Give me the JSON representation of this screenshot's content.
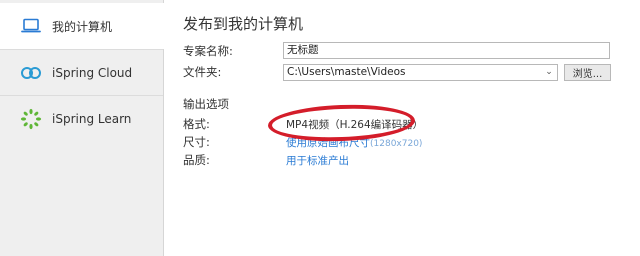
{
  "sidebar": {
    "items": [
      {
        "label": "我的计算机",
        "icon": "laptop-icon"
      },
      {
        "label": "iSpring Cloud",
        "icon": "cloud-icon"
      },
      {
        "label": "iSpring Learn",
        "icon": "learn-icon"
      }
    ]
  },
  "main": {
    "title": "发布到我的计算机",
    "project_name": {
      "label": "专案名称:",
      "value": "无标题"
    },
    "folder": {
      "label": "文件夹:",
      "value": "C:\\Users\\maste\\Videos",
      "browse_label": "浏览..."
    },
    "output_section": "输出选项",
    "format": {
      "label": "格式:",
      "value": "MP4视频（H.264编译码器）"
    },
    "size": {
      "label": "尺寸:",
      "link": "使用原始画布尺寸",
      "detail": "(1280x720)"
    },
    "quality": {
      "label": "品质:",
      "link": "用于标准产出"
    }
  },
  "colors": {
    "accent": "#2a7bd4",
    "annotation": "#d41d2a",
    "sidebar_bg": "#efefef"
  }
}
